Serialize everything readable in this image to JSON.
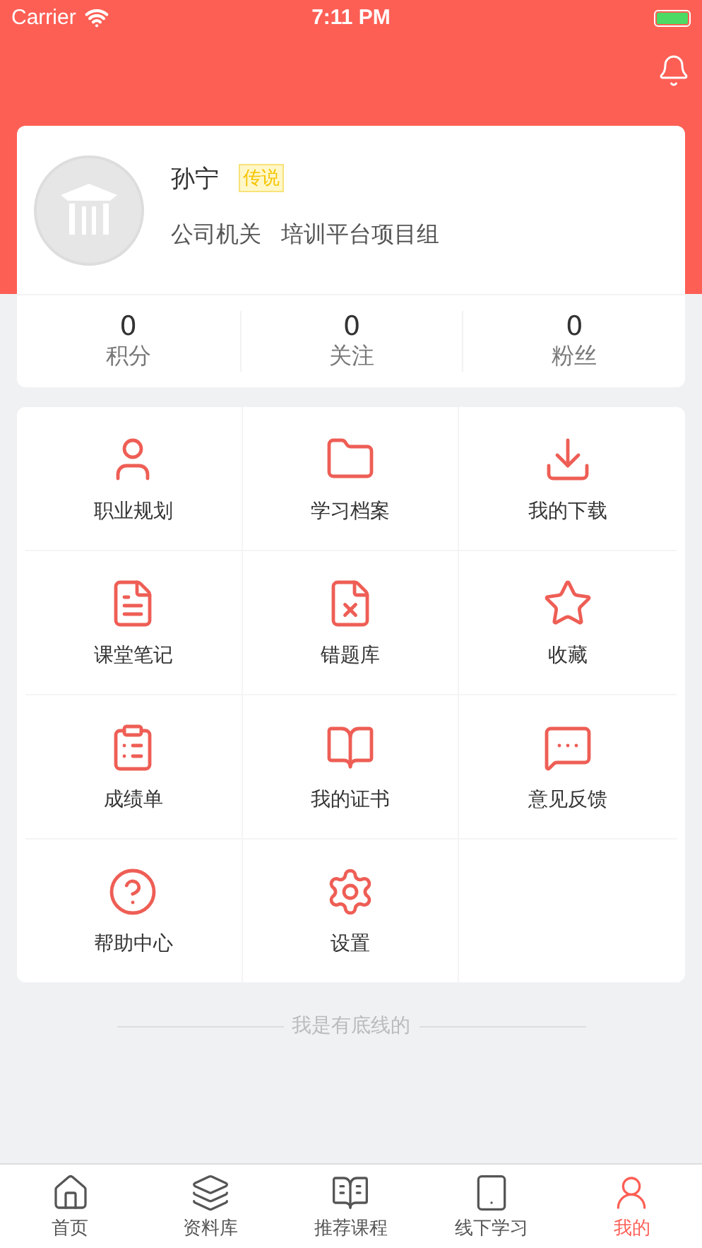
{
  "status_bar": {
    "carrier": "Carrier",
    "time": "7:11 PM"
  },
  "profile": {
    "name": "孙宁",
    "badge": "传说",
    "department": "公司机关",
    "group": "培训平台项目组"
  },
  "stats": [
    {
      "value": "0",
      "label": "积分"
    },
    {
      "value": "0",
      "label": "关注"
    },
    {
      "value": "0",
      "label": "粉丝"
    }
  ],
  "menu": [
    {
      "label": "职业规划"
    },
    {
      "label": "学习档案"
    },
    {
      "label": "我的下载"
    },
    {
      "label": "课堂笔记"
    },
    {
      "label": "错题库"
    },
    {
      "label": "收藏"
    },
    {
      "label": "成绩单"
    },
    {
      "label": "我的证书"
    },
    {
      "label": "意见反馈"
    },
    {
      "label": "帮助中心"
    },
    {
      "label": "设置"
    }
  ],
  "footer_note": "我是有底线的",
  "tab_bar": [
    {
      "label": "首页",
      "selected": false
    },
    {
      "label": "资料库",
      "selected": false
    },
    {
      "label": "推荐课程",
      "selected": false
    },
    {
      "label": "线下学习",
      "selected": false
    },
    {
      "label": "我的",
      "selected": true
    }
  ]
}
